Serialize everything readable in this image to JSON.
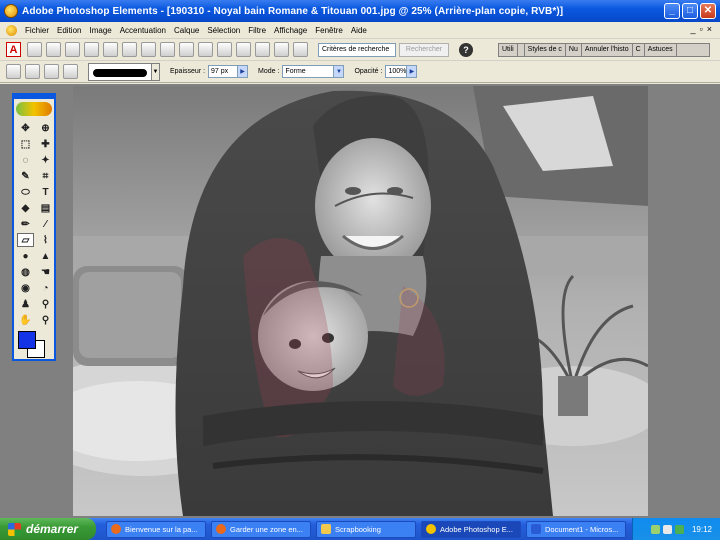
{
  "window": {
    "title": "Adobe Photoshop Elements - [190310 - Noyal bain Romane & Titouan 001.jpg @ 25% (Arrière-plan copie, RVB*)]",
    "minimize": "_",
    "maximize": "□",
    "close": "✕"
  },
  "menu": [
    "Fichier",
    "Edition",
    "Image",
    "Accentuation",
    "Calque",
    "Sélection",
    "Filtre",
    "Affichage",
    "Fenêtre",
    "Aide"
  ],
  "mdi_controls": [
    "_",
    "▫",
    "×"
  ],
  "toolbar": {
    "search_value": "Critères de recherche",
    "search_button": "Rechercher",
    "help": "?",
    "palette_tabs": [
      "Utili",
      "",
      "Styles de c",
      "Nu",
      "Annuler l'histo",
      "C",
      "Astuces"
    ]
  },
  "options": {
    "thickness_label": "Epaisseur :",
    "thickness_value": "97 px",
    "mode_label": "Mode :",
    "mode_value": "Forme",
    "opacity_label": "Opacité :",
    "opacity_value": "100%"
  },
  "toolbox": {
    "tools": [
      "move-icon",
      "zoom-in-icon",
      "marquee-icon",
      "crosshair-icon",
      "lasso-icon",
      "magic-wand-icon",
      "selection-brush-icon",
      "crop-icon",
      "cookie-cutter-icon",
      "type-icon",
      "paint-bucket-icon",
      "gradient-icon",
      "pencil-icon",
      "brush-icon",
      "eraser-icon",
      "impressionist-brush-icon",
      "blur-icon",
      "sharpen-icon",
      "sponge-icon",
      "smudge-icon",
      "red-eye-icon",
      "dodge-icon",
      "stamp-icon",
      "eyedropper-icon",
      "hand-icon",
      "zoom-icon"
    ],
    "foreground_color": "#1433e6",
    "background_color": "#ffffff"
  },
  "taskbar": {
    "start_label": "démarrer",
    "tasks": [
      {
        "label": "Bienvenue sur la pa...",
        "active": false
      },
      {
        "label": "Garder une zone en...",
        "active": false
      },
      {
        "label": "Scrapbooking",
        "active": false
      },
      {
        "label": "Adobe Photoshop E...",
        "active": true
      },
      {
        "label": "Document1 - Micros...",
        "active": false
      }
    ],
    "clock": "19:12"
  }
}
